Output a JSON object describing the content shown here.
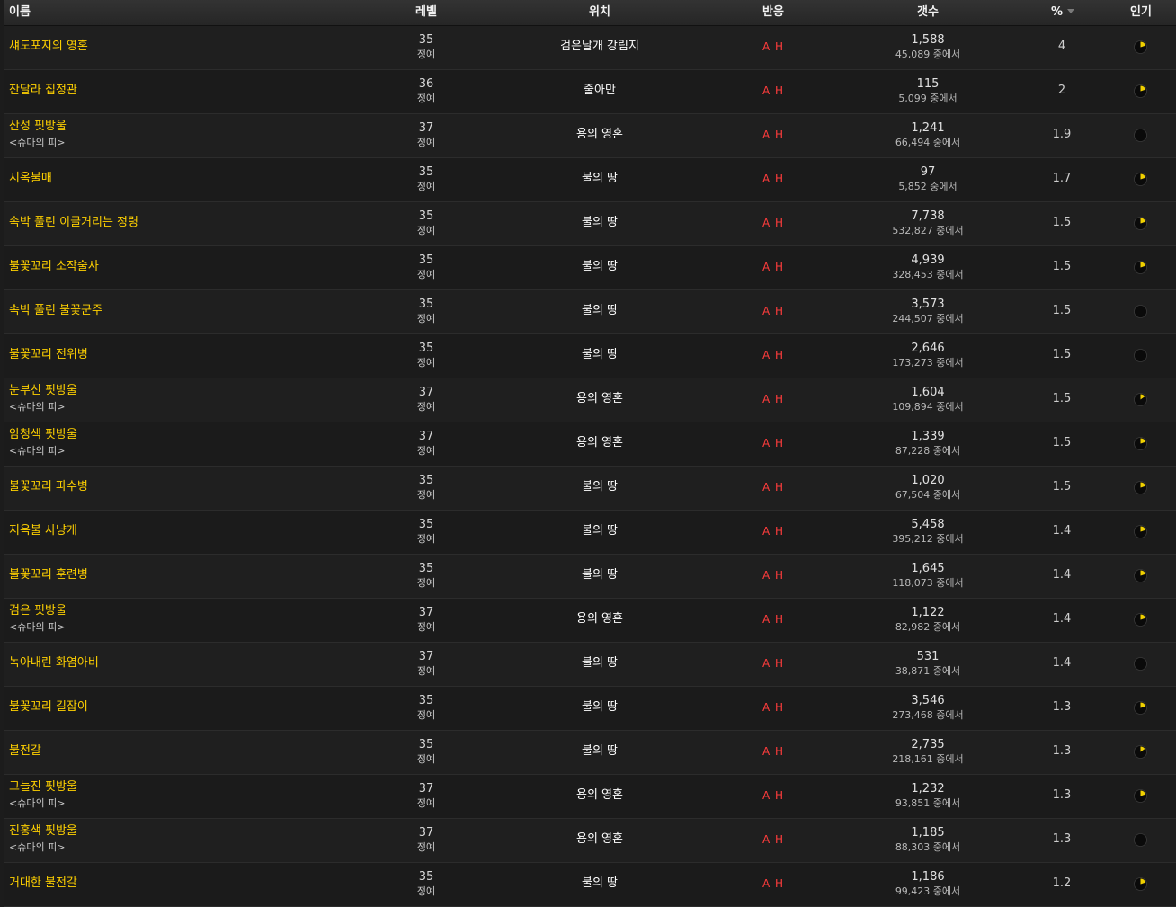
{
  "header": {
    "name": "이름",
    "level": "레벨",
    "location": "위치",
    "react": "반응",
    "count": "갯수",
    "percent": "%",
    "popularity": "인기"
  },
  "rows": [
    {
      "name": "섀도포지의 영혼",
      "tag": "",
      "level": "35",
      "level_type": "정예",
      "location": "검은날개 강림지",
      "react": "A H",
      "count": "1,588",
      "total": "45,089 중에서",
      "percent": "4",
      "popularity": 0.2
    },
    {
      "name": "잔달라 집정관",
      "tag": "",
      "level": "36",
      "level_type": "정예",
      "location": "줄아만",
      "react": "A H",
      "count": "115",
      "total": "5,099 중에서",
      "percent": "2",
      "popularity": 0.2
    },
    {
      "name": "산성 핏방울",
      "tag": "<슈마의 피>",
      "level": "37",
      "level_type": "정예",
      "location": "용의 영혼",
      "react": "A H",
      "count": "1,241",
      "total": "66,494 중에서",
      "percent": "1.9",
      "popularity": 0.0
    },
    {
      "name": "지옥불매",
      "tag": "",
      "level": "35",
      "level_type": "정예",
      "location": "불의 땅",
      "react": "A H",
      "count": "97",
      "total": "5,852 중에서",
      "percent": "1.7",
      "popularity": 0.2
    },
    {
      "name": "속박 풀린 이글거리는 정령",
      "tag": "",
      "level": "35",
      "level_type": "정예",
      "location": "불의 땅",
      "react": "A H",
      "count": "7,738",
      "total": "532,827 중에서",
      "percent": "1.5",
      "popularity": 0.2
    },
    {
      "name": "불꽃꼬리 소작술사",
      "tag": "",
      "level": "35",
      "level_type": "정예",
      "location": "불의 땅",
      "react": "A H",
      "count": "4,939",
      "total": "328,453 중에서",
      "percent": "1.5",
      "popularity": 0.2
    },
    {
      "name": "속박 풀린 불꽃군주",
      "tag": "",
      "level": "35",
      "level_type": "정예",
      "location": "불의 땅",
      "react": "A H",
      "count": "3,573",
      "total": "244,507 중에서",
      "percent": "1.5",
      "popularity": 0.0
    },
    {
      "name": "불꽃꼬리 전위병",
      "tag": "",
      "level": "35",
      "level_type": "정예",
      "location": "불의 땅",
      "react": "A H",
      "count": "2,646",
      "total": "173,273 중에서",
      "percent": "1.5",
      "popularity": 0.0
    },
    {
      "name": "눈부신 핏방울",
      "tag": "<슈마의 피>",
      "level": "37",
      "level_type": "정예",
      "location": "용의 영혼",
      "react": "A H",
      "count": "1,604",
      "total": "109,894 중에서",
      "percent": "1.5",
      "popularity": 0.15
    },
    {
      "name": "암청색 핏방울",
      "tag": "<슈마의 피>",
      "level": "37",
      "level_type": "정예",
      "location": "용의 영혼",
      "react": "A H",
      "count": "1,339",
      "total": "87,228 중에서",
      "percent": "1.5",
      "popularity": 0.2
    },
    {
      "name": "불꽃꼬리 파수병",
      "tag": "",
      "level": "35",
      "level_type": "정예",
      "location": "불의 땅",
      "react": "A H",
      "count": "1,020",
      "total": "67,504 중에서",
      "percent": "1.5",
      "popularity": 0.2
    },
    {
      "name": "지옥불 사냥개",
      "tag": "",
      "level": "35",
      "level_type": "정예",
      "location": "불의 땅",
      "react": "A H",
      "count": "5,458",
      "total": "395,212 중에서",
      "percent": "1.4",
      "popularity": 0.2
    },
    {
      "name": "불꽃꼬리 훈련병",
      "tag": "",
      "level": "35",
      "level_type": "정예",
      "location": "불의 땅",
      "react": "A H",
      "count": "1,645",
      "total": "118,073 중에서",
      "percent": "1.4",
      "popularity": 0.2
    },
    {
      "name": "검은 핏방울",
      "tag": "<슈마의 피>",
      "level": "37",
      "level_type": "정예",
      "location": "용의 영혼",
      "react": "A H",
      "count": "1,122",
      "total": "82,982 중에서",
      "percent": "1.4",
      "popularity": 0.2
    },
    {
      "name": "녹아내린 화염아비",
      "tag": "",
      "level": "37",
      "level_type": "정예",
      "location": "불의 땅",
      "react": "A H",
      "count": "531",
      "total": "38,871 중에서",
      "percent": "1.4",
      "popularity": 0.0
    },
    {
      "name": "불꽃꼬리 길잡이",
      "tag": "",
      "level": "35",
      "level_type": "정예",
      "location": "불의 땅",
      "react": "A H",
      "count": "3,546",
      "total": "273,468 중에서",
      "percent": "1.3",
      "popularity": 0.2
    },
    {
      "name": "불전갈",
      "tag": "",
      "level": "35",
      "level_type": "정예",
      "location": "불의 땅",
      "react": "A H",
      "count": "2,735",
      "total": "218,161 중에서",
      "percent": "1.3",
      "popularity": 0.15
    },
    {
      "name": "그늘진 핏방울",
      "tag": "<슈마의 피>",
      "level": "37",
      "level_type": "정예",
      "location": "용의 영혼",
      "react": "A H",
      "count": "1,232",
      "total": "93,851 중에서",
      "percent": "1.3",
      "popularity": 0.2
    },
    {
      "name": "진홍색 핏방울",
      "tag": "<슈마의 피>",
      "level": "37",
      "level_type": "정예",
      "location": "용의 영혼",
      "react": "A H",
      "count": "1,185",
      "total": "88,303 중에서",
      "percent": "1.3",
      "popularity": 0.0
    },
    {
      "name": "거대한 불전갈",
      "tag": "",
      "level": "35",
      "level_type": "정예",
      "location": "불의 땅",
      "react": "A H",
      "count": "1,186",
      "total": "99,423 중에서",
      "percent": "1.2",
      "popularity": 0.2
    }
  ],
  "colors": {
    "name": "#ffd100",
    "react": "#ff3c3c",
    "pie_fill": "#f0d000",
    "pie_bg": "#0a0a0a"
  }
}
